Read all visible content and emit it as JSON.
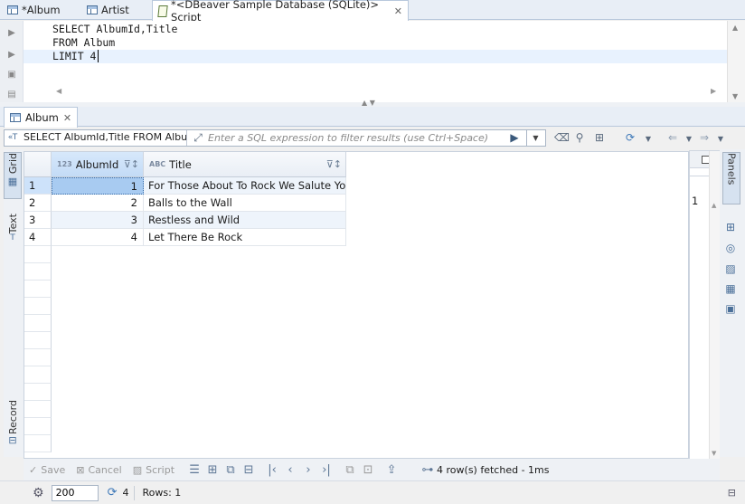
{
  "editor_tabs": [
    {
      "label": "*Album",
      "icon": "table-icon",
      "active": false
    },
    {
      "label": "Artist",
      "icon": "table-icon",
      "active": false
    },
    {
      "label": "*<DBeaver Sample Database (SQLite)> Script",
      "icon": "script-icon",
      "active": true
    }
  ],
  "editor": {
    "lines": [
      "SELECT AlbumId,Title",
      "FROM Album",
      "LIMIT 4"
    ]
  },
  "results_tab": {
    "label": "Album"
  },
  "filter": {
    "query_text": "SELECT AlbumId,Title FROM Albu",
    "placeholder": "Enter a SQL expression to filter results (use Ctrl+Space)"
  },
  "side_tabs": {
    "grid": "Grid",
    "text": "Text",
    "record": "Record",
    "panels": "Panels"
  },
  "grid": {
    "columns": [
      {
        "name": "AlbumId",
        "type_badge": "123"
      },
      {
        "name": "Title",
        "type_badge": "ABC"
      }
    ],
    "rows": [
      {
        "num": "1",
        "album_id": "1",
        "title": "For Those About To Rock We Salute You"
      },
      {
        "num": "2",
        "album_id": "2",
        "title": "Balls to the Wall"
      },
      {
        "num": "3",
        "album_id": "3",
        "title": "Restless and Wild"
      },
      {
        "num": "4",
        "album_id": "4",
        "title": "Let There Be Rock"
      }
    ]
  },
  "right_panel": {
    "value": "1"
  },
  "bottom_toolbar": {
    "save": "Save",
    "cancel": "Cancel",
    "script": "Script",
    "status": "4 row(s) fetched - 1ms"
  },
  "statusbar": {
    "fetch_size": "200",
    "refresh_count": "4",
    "rows": "Rows: 1"
  },
  "colors": {
    "selection": "#cde2fa",
    "accent": "#4a6f99"
  }
}
